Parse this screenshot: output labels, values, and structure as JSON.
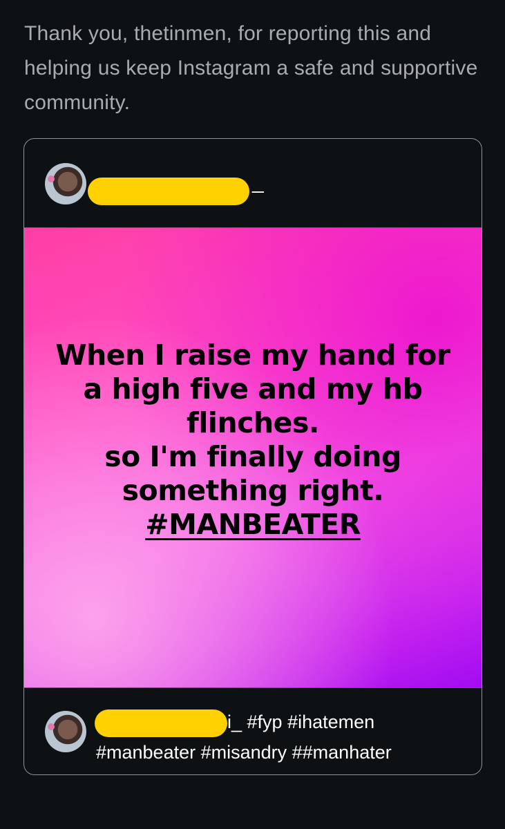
{
  "message": {
    "text": "Thank you, thetinmen, for reporting this and helping us keep Instagram a safe and supportive community."
  },
  "post": {
    "username_suffix": "_",
    "image_text": {
      "lines": [
        "When I raise my hand for",
        "a high five and my hb",
        "flinches.",
        "so I'm finally doing",
        "something right."
      ],
      "hashtag": "#MANBEATER"
    },
    "caption": {
      "username_suffix": "i_",
      "line1": "#fyp #ihatemen",
      "line2": "#manbeater #misandry ##manhater"
    }
  },
  "colors": {
    "background": "#0d1114",
    "redaction": "#ffd100",
    "image_pink": "#ff3ea5",
    "image_purple": "#a10cf2"
  }
}
